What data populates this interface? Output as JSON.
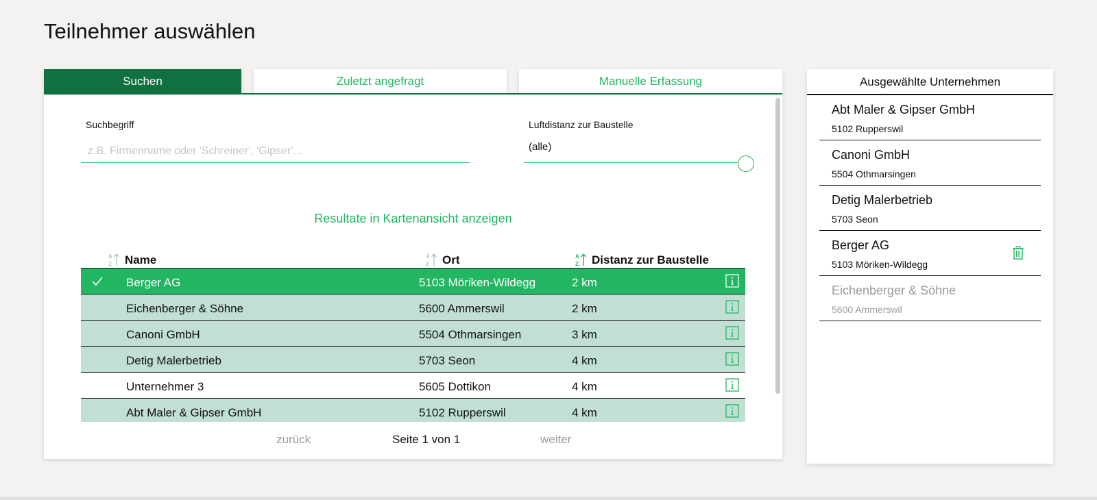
{
  "page": {
    "title": "Teilnehmer auswählen"
  },
  "tabs": [
    {
      "label": "Suchen",
      "active": true
    },
    {
      "label": "Zuletzt angefragt",
      "active": false
    },
    {
      "label": "Manuelle Erfassung",
      "active": false
    }
  ],
  "search": {
    "label": "Suchbegriff",
    "placeholder": "z.B. Firmenname oder 'Schreiner', 'Gipser'...",
    "value": ""
  },
  "distance": {
    "label": "Luftdistanz zur Baustelle",
    "value": "(alle)",
    "slider_fraction": 1.0
  },
  "map_link": "Resultate in Kartenansicht anzeigen",
  "table": {
    "headers": {
      "name": "Name",
      "place": "Ort",
      "distance": "Distanz zur Baustelle"
    },
    "rows": [
      {
        "name": "Berger AG",
        "place": "5103 Möriken-Wildegg",
        "distance": "2 km",
        "state": "selected"
      },
      {
        "name": "Eichenberger & Söhne",
        "place": "5600 Ammerswil",
        "distance": "2 km",
        "state": "added"
      },
      {
        "name": "Canoni GmbH",
        "place": "5504 Othmarsingen",
        "distance": "3 km",
        "state": "added"
      },
      {
        "name": "Detig Malerbetrieb",
        "place": "5703 Seon",
        "distance": "4 km",
        "state": "added"
      },
      {
        "name": "Unternehmer 3",
        "place": "5605 Dottikon",
        "distance": "4 km",
        "state": "none"
      },
      {
        "name": "Abt Maler & Gipser GmbH",
        "place": "5102 Rupperswil",
        "distance": "4 km",
        "state": "added"
      }
    ]
  },
  "pager": {
    "prev": "zurück",
    "info": "Seite 1 von 1",
    "next": "weiter"
  },
  "selected_panel": {
    "title": "Ausgewählte Unternehmen",
    "items": [
      {
        "name": "Abt Maler & Gipser GmbH",
        "place": "5102 Rupperswil"
      },
      {
        "name": "Canoni GmbH",
        "place": "5504 Othmarsingen"
      },
      {
        "name": "Detig Malerbetrieb",
        "place": "5703 Seon"
      },
      {
        "name": "Berger AG",
        "place": "5103 Möriken-Wildegg"
      },
      {
        "name": "Eichenberger & Söhne",
        "place": "5600 Ammerswil"
      }
    ]
  },
  "colors": {
    "accent": "#22b562",
    "accent_dark": "#11703f",
    "row_tint": "#c1dfd2",
    "background": "#f3f2f1"
  },
  "icons": {
    "sort": "sort-az-icon",
    "check": "check-icon",
    "info": "info-icon",
    "trash": "trash-icon"
  }
}
